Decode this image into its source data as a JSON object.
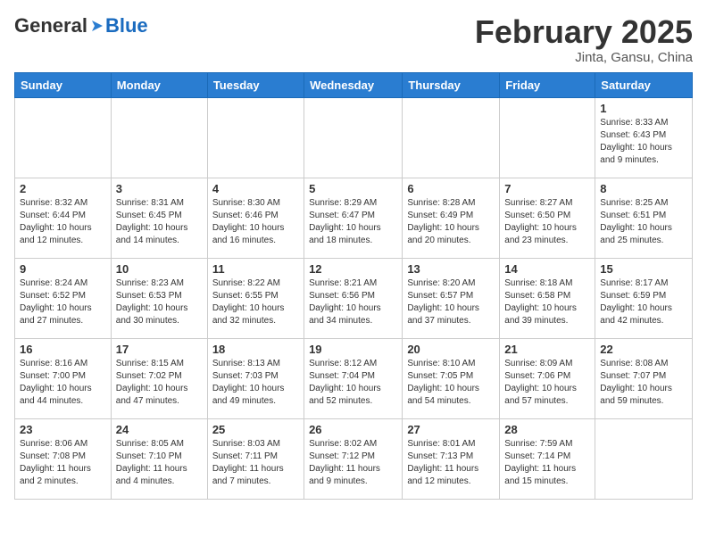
{
  "header": {
    "logo_general": "General",
    "logo_blue": "Blue",
    "month_title": "February 2025",
    "location": "Jinta, Gansu, China"
  },
  "weekdays": [
    "Sunday",
    "Monday",
    "Tuesday",
    "Wednesday",
    "Thursday",
    "Friday",
    "Saturday"
  ],
  "weeks": [
    [
      {
        "day": "",
        "info": ""
      },
      {
        "day": "",
        "info": ""
      },
      {
        "day": "",
        "info": ""
      },
      {
        "day": "",
        "info": ""
      },
      {
        "day": "",
        "info": ""
      },
      {
        "day": "",
        "info": ""
      },
      {
        "day": "1",
        "info": "Sunrise: 8:33 AM\nSunset: 6:43 PM\nDaylight: 10 hours\nand 9 minutes."
      }
    ],
    [
      {
        "day": "2",
        "info": "Sunrise: 8:32 AM\nSunset: 6:44 PM\nDaylight: 10 hours\nand 12 minutes."
      },
      {
        "day": "3",
        "info": "Sunrise: 8:31 AM\nSunset: 6:45 PM\nDaylight: 10 hours\nand 14 minutes."
      },
      {
        "day": "4",
        "info": "Sunrise: 8:30 AM\nSunset: 6:46 PM\nDaylight: 10 hours\nand 16 minutes."
      },
      {
        "day": "5",
        "info": "Sunrise: 8:29 AM\nSunset: 6:47 PM\nDaylight: 10 hours\nand 18 minutes."
      },
      {
        "day": "6",
        "info": "Sunrise: 8:28 AM\nSunset: 6:49 PM\nDaylight: 10 hours\nand 20 minutes."
      },
      {
        "day": "7",
        "info": "Sunrise: 8:27 AM\nSunset: 6:50 PM\nDaylight: 10 hours\nand 23 minutes."
      },
      {
        "day": "8",
        "info": "Sunrise: 8:25 AM\nSunset: 6:51 PM\nDaylight: 10 hours\nand 25 minutes."
      }
    ],
    [
      {
        "day": "9",
        "info": "Sunrise: 8:24 AM\nSunset: 6:52 PM\nDaylight: 10 hours\nand 27 minutes."
      },
      {
        "day": "10",
        "info": "Sunrise: 8:23 AM\nSunset: 6:53 PM\nDaylight: 10 hours\nand 30 minutes."
      },
      {
        "day": "11",
        "info": "Sunrise: 8:22 AM\nSunset: 6:55 PM\nDaylight: 10 hours\nand 32 minutes."
      },
      {
        "day": "12",
        "info": "Sunrise: 8:21 AM\nSunset: 6:56 PM\nDaylight: 10 hours\nand 34 minutes."
      },
      {
        "day": "13",
        "info": "Sunrise: 8:20 AM\nSunset: 6:57 PM\nDaylight: 10 hours\nand 37 minutes."
      },
      {
        "day": "14",
        "info": "Sunrise: 8:18 AM\nSunset: 6:58 PM\nDaylight: 10 hours\nand 39 minutes."
      },
      {
        "day": "15",
        "info": "Sunrise: 8:17 AM\nSunset: 6:59 PM\nDaylight: 10 hours\nand 42 minutes."
      }
    ],
    [
      {
        "day": "16",
        "info": "Sunrise: 8:16 AM\nSunset: 7:00 PM\nDaylight: 10 hours\nand 44 minutes."
      },
      {
        "day": "17",
        "info": "Sunrise: 8:15 AM\nSunset: 7:02 PM\nDaylight: 10 hours\nand 47 minutes."
      },
      {
        "day": "18",
        "info": "Sunrise: 8:13 AM\nSunset: 7:03 PM\nDaylight: 10 hours\nand 49 minutes."
      },
      {
        "day": "19",
        "info": "Sunrise: 8:12 AM\nSunset: 7:04 PM\nDaylight: 10 hours\nand 52 minutes."
      },
      {
        "day": "20",
        "info": "Sunrise: 8:10 AM\nSunset: 7:05 PM\nDaylight: 10 hours\nand 54 minutes."
      },
      {
        "day": "21",
        "info": "Sunrise: 8:09 AM\nSunset: 7:06 PM\nDaylight: 10 hours\nand 57 minutes."
      },
      {
        "day": "22",
        "info": "Sunrise: 8:08 AM\nSunset: 7:07 PM\nDaylight: 10 hours\nand 59 minutes."
      }
    ],
    [
      {
        "day": "23",
        "info": "Sunrise: 8:06 AM\nSunset: 7:08 PM\nDaylight: 11 hours\nand 2 minutes."
      },
      {
        "day": "24",
        "info": "Sunrise: 8:05 AM\nSunset: 7:10 PM\nDaylight: 11 hours\nand 4 minutes."
      },
      {
        "day": "25",
        "info": "Sunrise: 8:03 AM\nSunset: 7:11 PM\nDaylight: 11 hours\nand 7 minutes."
      },
      {
        "day": "26",
        "info": "Sunrise: 8:02 AM\nSunset: 7:12 PM\nDaylight: 11 hours\nand 9 minutes."
      },
      {
        "day": "27",
        "info": "Sunrise: 8:01 AM\nSunset: 7:13 PM\nDaylight: 11 hours\nand 12 minutes."
      },
      {
        "day": "28",
        "info": "Sunrise: 7:59 AM\nSunset: 7:14 PM\nDaylight: 11 hours\nand 15 minutes."
      },
      {
        "day": "",
        "info": ""
      }
    ]
  ]
}
